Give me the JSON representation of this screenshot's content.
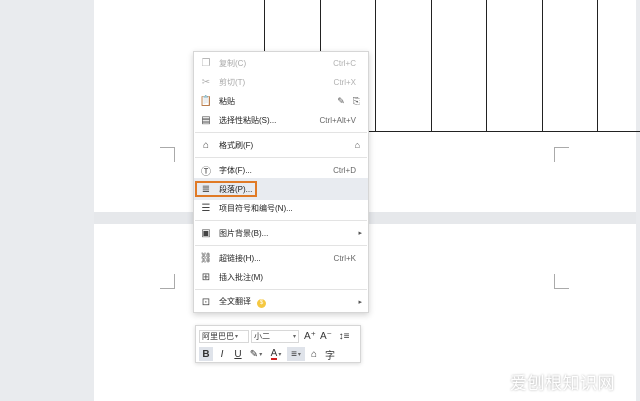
{
  "context_menu": {
    "items": [
      {
        "icon": "copy-icon",
        "label": "复制(C)",
        "shortcut": "Ctrl+C",
        "disabled": true
      },
      {
        "icon": "cut-icon",
        "label": "剪切(T)",
        "shortcut": "Ctrl+X",
        "disabled": true
      },
      {
        "icon": "paste-icon",
        "label": "粘贴",
        "shortcut": "",
        "disabled": false
      },
      {
        "icon": "paste-special-icon",
        "label": "选择性粘贴(S)...",
        "shortcut": "Ctrl+Alt+V",
        "disabled": false
      },
      {
        "icon": "format-painter-icon",
        "label": "格式刷(F)",
        "shortcut": "",
        "disabled": false
      },
      {
        "icon": "font-icon",
        "label": "字体(F)...",
        "shortcut": "Ctrl+D",
        "disabled": false
      },
      {
        "icon": "paragraph-icon",
        "label": "段落(P)...",
        "shortcut": "",
        "disabled": false,
        "highlighted": true
      },
      {
        "icon": "bullets-numbering-icon",
        "label": "项目符号和编号(N)...",
        "shortcut": "",
        "disabled": false
      },
      {
        "icon": "image-background-icon",
        "label": "图片背景(B)...",
        "shortcut": "",
        "disabled": false,
        "submenu": true
      },
      {
        "icon": "hyperlink-icon",
        "label": "超链接(H)...",
        "shortcut": "Ctrl+K",
        "disabled": false
      },
      {
        "icon": "insert-comment-icon",
        "label": "插入批注(M)",
        "shortcut": "",
        "disabled": false
      },
      {
        "icon": "translate-icon",
        "label": "全文翻译",
        "shortcut": "",
        "disabled": false,
        "submenu": true
      }
    ]
  },
  "mini_toolbar": {
    "font_name": "阿里巴巴",
    "font_size": "小二",
    "grow_font": "A⁺",
    "shrink_font": "A⁻",
    "bold": "B",
    "italic": "I",
    "underline": "U"
  },
  "watermark": "爱刨根知识网",
  "colors": {
    "highlight_border": "#e07a26",
    "hover_bg": "#e8ebf0",
    "font_color_bar": "#d02020"
  }
}
